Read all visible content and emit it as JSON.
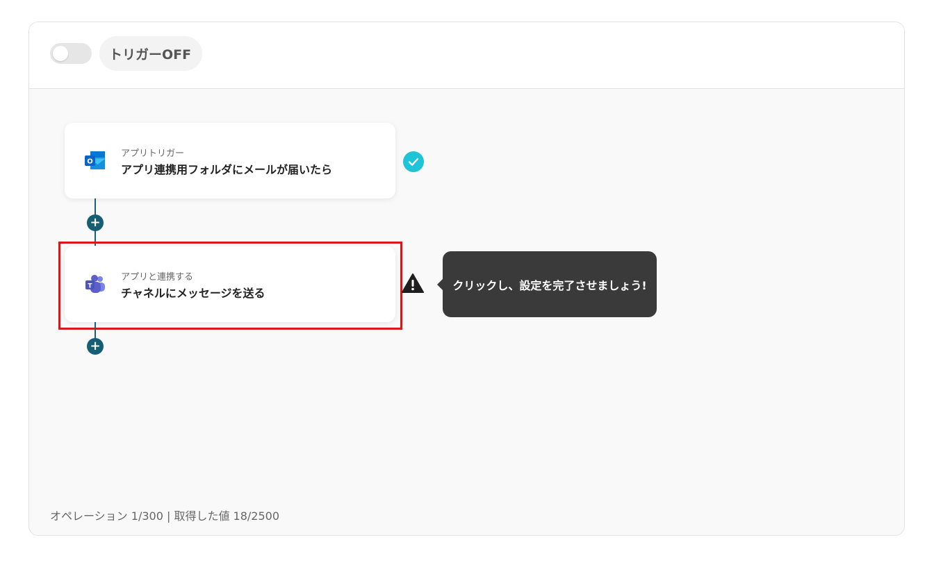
{
  "header": {
    "trigger_toggle_state": "off",
    "trigger_label": "トリガーOFF"
  },
  "steps": [
    {
      "type_label": "アプリトリガー",
      "title": "アプリ連携用フォルダにメールが届いたら",
      "icon": "outlook-icon",
      "status": "complete-check-icon"
    },
    {
      "type_label": "アプリと連携する",
      "title": "チャネルにメッセージを送る",
      "icon": "teams-icon",
      "status": "warning-icon"
    }
  ],
  "tooltip": {
    "text": "クリックし、設定を完了させましょう!"
  },
  "footer": {
    "text": "オペレーション 1/300 | 取得した値 18/2500"
  },
  "colors": {
    "connector": "#155e73",
    "check": "#1fc4d6",
    "highlight": "#d9161c",
    "tooltip_bg": "#3a3a3a",
    "outlook_blue": "#0a64c8",
    "teams_purple": "#5b5fc7"
  }
}
